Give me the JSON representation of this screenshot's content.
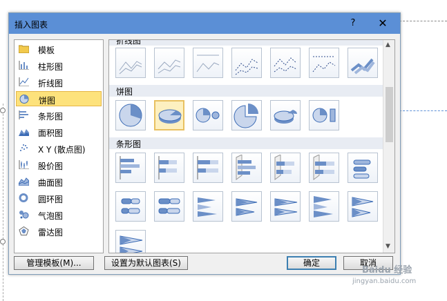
{
  "dialog": {
    "title": "插入图表",
    "help": "?",
    "close": "✕"
  },
  "categories": [
    {
      "label": "模板",
      "icon": "folder-icon"
    },
    {
      "label": "柱形图",
      "icon": "column-chart-icon"
    },
    {
      "label": "折线图",
      "icon": "line-chart-icon"
    },
    {
      "label": "饼图",
      "icon": "pie-chart-icon",
      "selected": true
    },
    {
      "label": "条形图",
      "icon": "bar-chart-icon"
    },
    {
      "label": "面积图",
      "icon": "area-chart-icon"
    },
    {
      "label": "X Y (散点图)",
      "icon": "scatter-chart-icon"
    },
    {
      "label": "股价图",
      "icon": "stock-chart-icon"
    },
    {
      "label": "曲面图",
      "icon": "surface-chart-icon"
    },
    {
      "label": "圆环图",
      "icon": "doughnut-chart-icon"
    },
    {
      "label": "气泡图",
      "icon": "bubble-chart-icon"
    },
    {
      "label": "雷达图",
      "icon": "radar-chart-icon"
    }
  ],
  "gallery": {
    "sections": {
      "line": "折线图",
      "pie": "饼图",
      "bar": "条形图"
    }
  },
  "buttons": {
    "manage_templates": "管理模板(M)...",
    "set_default": "设置为默认图表(S)",
    "ok": "确定",
    "cancel": "取消"
  },
  "watermark": {
    "text": "Baidu 经验",
    "url": "jingyan.baidu.com"
  }
}
